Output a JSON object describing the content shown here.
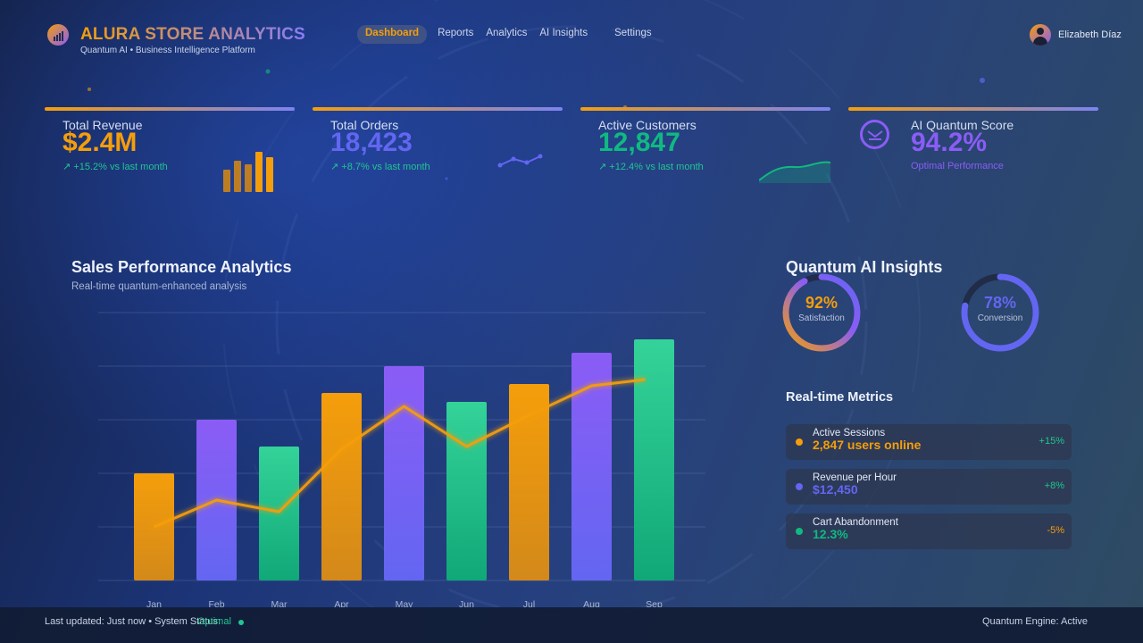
{
  "header": {
    "brand": "ALURA STORE ANALYTICS",
    "tagline": "Quantum AI • Business Intelligence Platform",
    "nav": [
      "Dashboard",
      "Reports",
      "Analytics",
      "AI Insights",
      "Settings"
    ],
    "active_nav": "Dashboard",
    "user_name": "Elizabeth Díaz"
  },
  "stats": [
    {
      "label": "Total Revenue",
      "value": "$2.4M",
      "delta": "↗ +15.2% vs last month",
      "color": "#f59e0b"
    },
    {
      "label": "Total Orders",
      "value": "18,423",
      "delta": "↗ +8.7% vs last month",
      "color": "#6366f1"
    },
    {
      "label": "Active Customers",
      "value": "12,847",
      "delta": "↗ +12.4% vs last month",
      "color": "#10b981"
    },
    {
      "label": "AI Quantum Score",
      "value": "94.2%",
      "delta": "Optimal Performance",
      "color": "#8b5cf6"
    }
  ],
  "sales_chart": {
    "title": "Sales Performance Analytics",
    "subtitle": "Real-time quantum-enhanced analysis"
  },
  "chart_data": {
    "type": "bar",
    "categories": [
      "Jan",
      "Feb",
      "Mar",
      "Apr",
      "May",
      "Jun",
      "Jul",
      "Aug",
      "Sep"
    ],
    "series": [
      {
        "values": [
          120,
          180,
          150,
          210,
          240,
          200,
          220,
          255,
          270
        ],
        "type": "bar"
      },
      {
        "values": [
          60,
          90,
          77,
          147,
          195,
          150,
          185,
          218,
          225
        ],
        "type": "line"
      }
    ],
    "bar_colors": [
      "orange",
      "purple",
      "green",
      "orange",
      "purple",
      "green",
      "orange",
      "purple",
      "green"
    ],
    "ylim": [
      0,
      300
    ],
    "grid": true
  },
  "ai_insights": {
    "title": "Quantum AI Insights",
    "rings": [
      {
        "pct": 92,
        "text": "92%",
        "label": "Satisfaction",
        "color": "#f59e0b"
      },
      {
        "pct": 78,
        "text": "78%",
        "label": "Conversion",
        "color": "#6366f1"
      }
    ]
  },
  "realtime": {
    "title": "Real-time Metrics",
    "items": [
      {
        "label": "Active Sessions",
        "value": "2,847 users online",
        "delta": "+15%",
        "dot": "#f59e0b",
        "value_color": "#f59e0b",
        "delta_color": "#22c58f"
      },
      {
        "label": "Revenue per Hour",
        "value": "$12,450",
        "delta": "+8%",
        "dot": "#6366f1",
        "value_color": "#6366f1",
        "delta_color": "#22c58f"
      },
      {
        "label": "Cart Abandonment",
        "value": "12.3%",
        "delta": "-5%",
        "dot": "#10b981",
        "value_color": "#10b981",
        "delta_color": "#f59e0b"
      }
    ]
  },
  "footer": {
    "left": "Last updated: Just now • System Status:",
    "status": "Optimal",
    "right": "Quantum Engine: Active"
  }
}
